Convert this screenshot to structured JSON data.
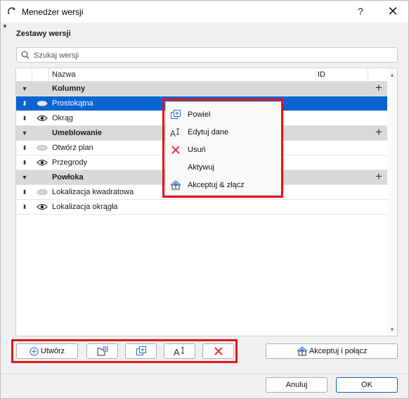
{
  "window": {
    "title": "Menedżer wersji",
    "help_label": "?",
    "close_label": "✕"
  },
  "section": {
    "title": "Zestawy wersji"
  },
  "search": {
    "placeholder": "Szukaj wersji"
  },
  "list": {
    "columns": {
      "name": "Nazwa",
      "id": "ID"
    },
    "rows": [
      {
        "type": "group",
        "name": "Kolumny"
      },
      {
        "type": "item",
        "name": "Prostokątna",
        "visible": false,
        "selected": true
      },
      {
        "type": "item",
        "name": "Okrąg",
        "visible": true
      },
      {
        "type": "group",
        "name": "Umeblowanie"
      },
      {
        "type": "item",
        "name": "Otwórz plan",
        "visible": false
      },
      {
        "type": "item",
        "name": "Przegrody",
        "visible": true
      },
      {
        "type": "group",
        "name": "Powłoka"
      },
      {
        "type": "item",
        "name": "Lokalizacja kwadratowa",
        "visible": false
      },
      {
        "type": "item",
        "name": "Lokalizacja okrągła",
        "visible": true
      }
    ]
  },
  "context_menu": {
    "items": [
      {
        "label": "Powiel",
        "icon": "duplicate-icon"
      },
      {
        "label": "Edytuj dane",
        "icon": "edit-text-icon"
      },
      {
        "label": "Usuń",
        "icon": "delete-x-icon"
      },
      {
        "label": "Aktywuj",
        "icon": ""
      },
      {
        "label": "Akceptuj & złącz",
        "icon": "accept-merge-icon"
      }
    ]
  },
  "toolbar": {
    "create_label": "Utwórz",
    "accept_merge_label": "Akceptuj i połącz"
  },
  "footer": {
    "cancel_label": "Anuluj",
    "ok_label": "OK"
  },
  "colors": {
    "selection": "#0a64d2",
    "highlight_box": "#e0151b",
    "delete": "#e53935",
    "icon_blue": "#2a6fc9"
  }
}
